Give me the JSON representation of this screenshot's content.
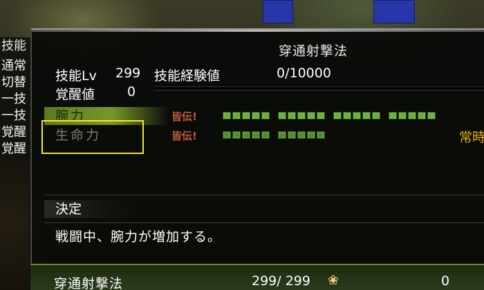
{
  "left_menu": {
    "title": "技能",
    "items": [
      "通常",
      "切替",
      "一技",
      "一技",
      "覚醒",
      "覚醒"
    ]
  },
  "panel": {
    "title": "穿通射撃法",
    "skill_lv_label": "技能Lv",
    "skill_lv_value": "299",
    "exp_label": "技能経験値",
    "exp_value": "0/10000",
    "awaken_label": "覚醒値",
    "awaken_value": "0"
  },
  "attributes": [
    {
      "label": "腕力",
      "kaiden": "皆伝!",
      "groups": [
        5,
        5,
        5,
        5
      ]
    },
    {
      "label": "生命力",
      "kaiden": "皆伝!",
      "groups": [
        5,
        5
      ],
      "tag": "常時"
    }
  ],
  "decision_label": "決定",
  "description": "戦闘中、腕力が増加する。",
  "bottom_row": {
    "name": "穿通射撃法",
    "level": "299/ 299",
    "value": "0"
  },
  "colors": {
    "highlight_box": "#f4ea1c",
    "kaiden": "#c25a3a",
    "segment": "#6ab03a",
    "tag": "#e9b200"
  },
  "icons": {
    "bottom_star": "cherry-blossom-icon"
  }
}
